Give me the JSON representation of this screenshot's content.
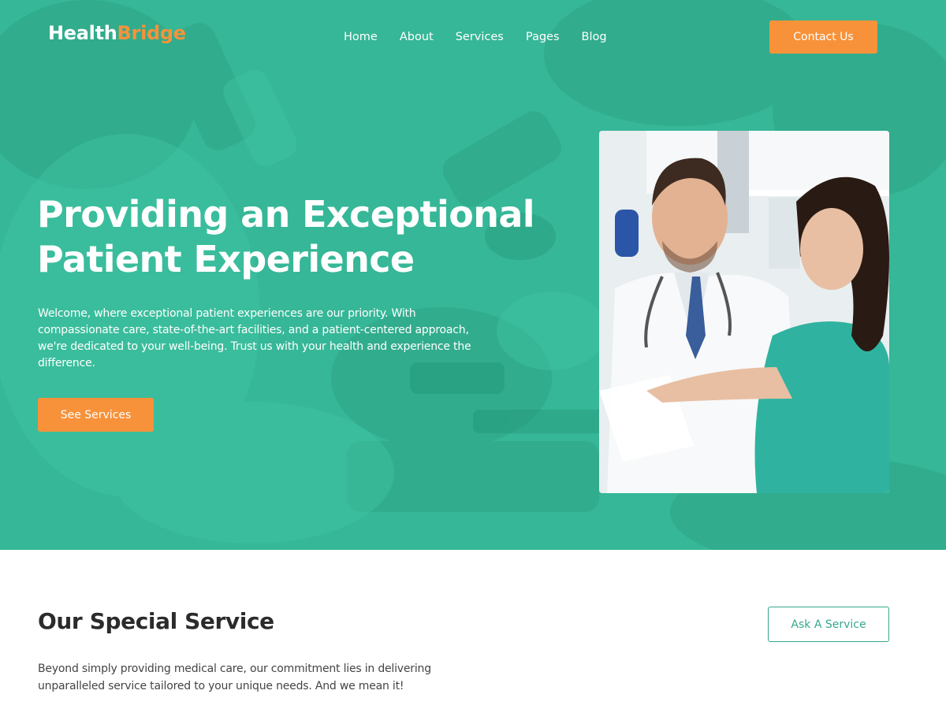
{
  "brand": {
    "name_part1": "Health",
    "name_part2": "Bridge"
  },
  "nav": {
    "items": [
      {
        "label": "Home"
      },
      {
        "label": "About"
      },
      {
        "label": "Services"
      },
      {
        "label": "Pages"
      },
      {
        "label": "Blog"
      }
    ],
    "contact_label": "Contact Us"
  },
  "hero": {
    "title_line1": "Providing an Exceptional",
    "title_line2": "Patient Experience",
    "description": "Welcome, where exceptional patient experiences are our priority. With compassionate care, state-of-the-art facilities, and a patient-centered approach, we're dedicated to your well-being. Trust us with your health and experience the difference.",
    "cta_label": "See Services"
  },
  "services": {
    "title": "Our Special Service",
    "description": "Beyond simply providing medical care, our commitment lies in delivering unparalleled service tailored to your unique needs. And we mean it!",
    "ask_label": "Ask A Service"
  },
  "colors": {
    "hero_overlay": "#35b696",
    "accent_orange": "#f7923a",
    "outline_green": "#35a88c",
    "heading_dark": "#2b2b2b"
  }
}
